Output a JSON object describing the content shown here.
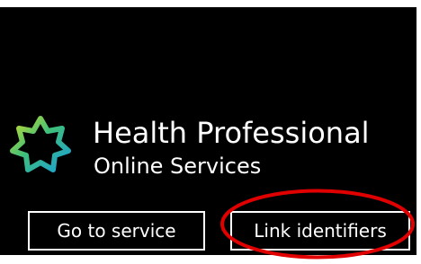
{
  "brand": {
    "title": "Health Professional",
    "subtitle": "Online Services",
    "logo_icon": "star-burst-logo-icon"
  },
  "actions": {
    "go_to_service_label": "Go to service",
    "link_identifiers_label": "Link identifiers"
  },
  "colors": {
    "background": "#000000",
    "text": "#ffffff",
    "annotation": "#e00000"
  }
}
